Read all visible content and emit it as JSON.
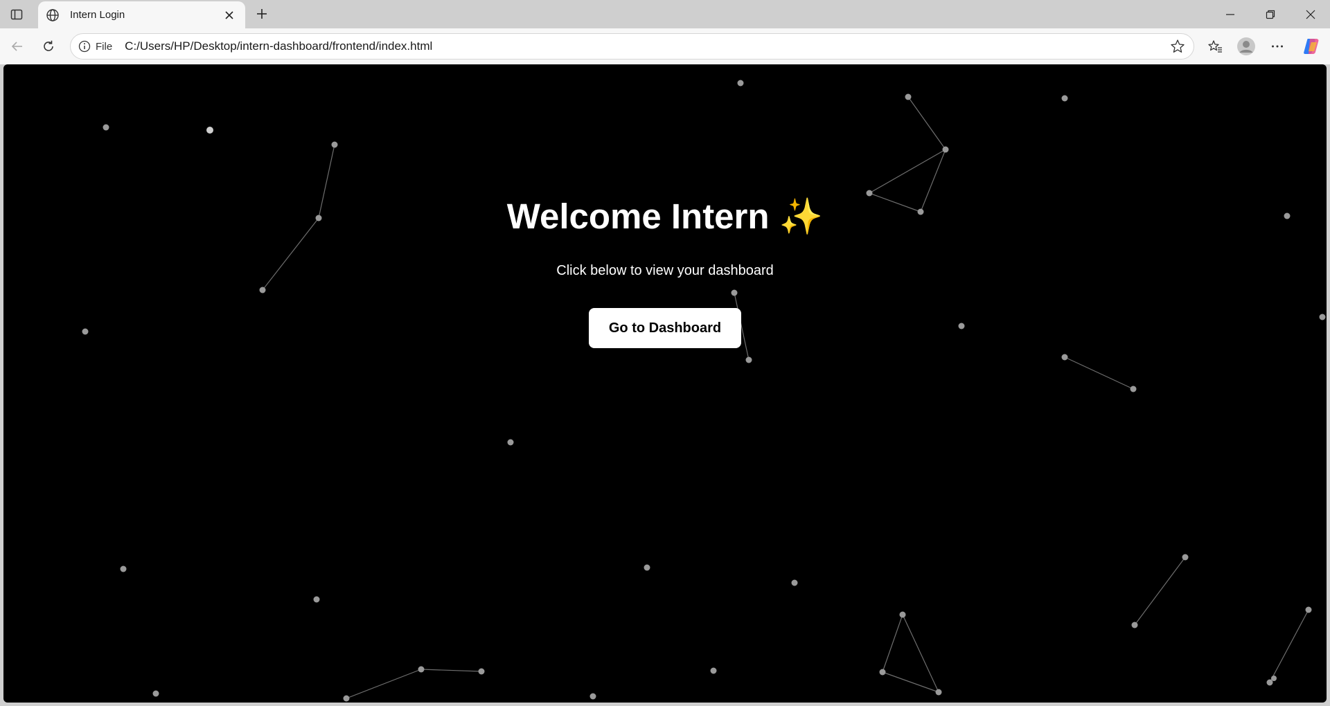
{
  "browser": {
    "tab": {
      "title": "Intern Login",
      "favicon": "globe-icon"
    },
    "address": {
      "scheme_label": "File",
      "url": "C:/Users/HP/Desktop/intern-dashboard/frontend/index.html"
    }
  },
  "page": {
    "title": "Welcome Intern",
    "title_emoji": "✨",
    "subtitle": "Click below to view your dashboard",
    "cta_label": "Go to Dashboard"
  },
  "colors": {
    "page_background": "#000000",
    "particle": "#9a9a9a",
    "link_line": "#6e6e6e",
    "button_bg": "#ffffff",
    "button_text": "#000000"
  }
}
